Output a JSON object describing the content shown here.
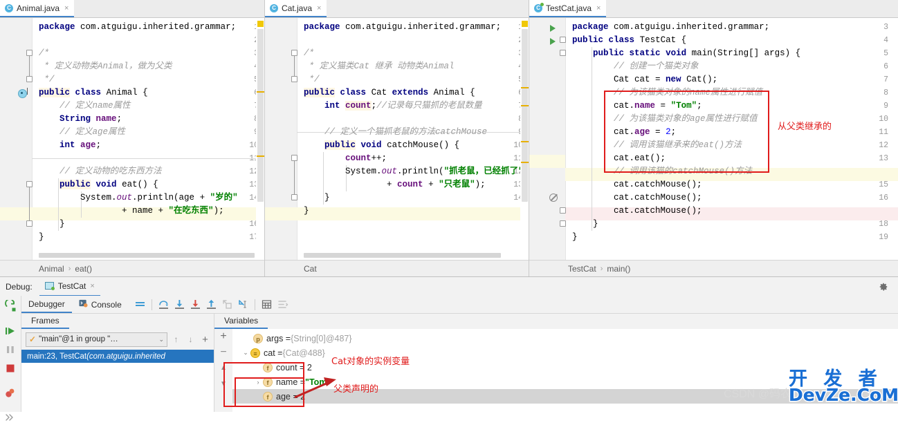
{
  "editors": [
    {
      "tab": {
        "label": "Animal.java",
        "icon": "java-class-icon",
        "modified": false,
        "close": "×"
      },
      "breadcrumb": [
        "Animal",
        "eat()"
      ],
      "first_line": 1,
      "lines": [
        {
          "n": 1,
          "html": "<span class=\"kw\">package</span> <span class=\"pln\">com.atguigu.inherited.grammar;</span>"
        },
        {
          "n": 2,
          "html": ""
        },
        {
          "n": 3,
          "html": "<span class=\"cmt\">/*</span>"
        },
        {
          "n": 4,
          "html": "<span class=\"cmt\"> * 定义动物类Animal，做为父类</span>"
        },
        {
          "n": 5,
          "html": "<span class=\"cmt\"> */</span>"
        },
        {
          "n": 6,
          "html": "<span class=\"kwhl\">public</span> <span class=\"kw\">class</span> <span class=\"pln\">Animal {</span>"
        },
        {
          "n": 7,
          "html": "    <span class=\"cmt\">// 定义name属性</span>"
        },
        {
          "n": 8,
          "html": "    <span class=\"kw\">String</span> <span class=\"fld\">name</span><span class=\"pln\">;</span>"
        },
        {
          "n": 9,
          "html": "    <span class=\"cmt\">// 定义age属性</span>"
        },
        {
          "n": 10,
          "html": "    <span class=\"kw\">int</span> <span class=\"fld\">age</span><span class=\"pln\">;</span>"
        },
        {
          "n": 11,
          "html": ""
        },
        {
          "n": 12,
          "html": "    <span class=\"cmt\">// 定义动物的吃东西方法</span>"
        },
        {
          "n": 13,
          "html": "    <span class=\"kwhl\">public</span> <span class=\"kw\">void</span> <span class=\"pln\">eat() {</span>"
        },
        {
          "n": 14,
          "html": "        <span class=\"pln\">System.</span><span class=\"stat\">out</span><span class=\"pln\">.println(age + </span><span class=\"str\">\"岁的\"</span>"
        },
        {
          "n": 15,
          "html": "                <span class=\"pln\">+ name + </span><span class=\"str\">\"在吃东西\"</span><span class=\"pln\">);</span>",
          "highlight": "yellow"
        },
        {
          "n": 16,
          "html": "    <span class=\"pln\">}</span>"
        },
        {
          "n": 17,
          "html": "<span class=\"pln\">}</span>"
        }
      ]
    },
    {
      "tab": {
        "label": "Cat.java",
        "icon": "java-class-icon",
        "modified": false,
        "close": "×"
      },
      "breadcrumb": [
        "Cat"
      ],
      "first_line": 1,
      "lines": [
        {
          "n": 1,
          "html": "<span class=\"kw\">package</span> <span class=\"pln\">com.atguigu.inherited.grammar;</span>"
        },
        {
          "n": 2,
          "html": ""
        },
        {
          "n": 3,
          "html": "<span class=\"cmt\">/*</span>"
        },
        {
          "n": 4,
          "html": "<span class=\"cmt\"> * 定义猫类Cat 继承 动物类Animal</span>"
        },
        {
          "n": 5,
          "html": "<span class=\"cmt\"> */</span>"
        },
        {
          "n": 6,
          "html": "<span class=\"kwhl\">public</span> <span class=\"kw\">class</span> <span class=\"pln\">Cat </span><span class=\"kw\">extends</span> <span class=\"pln\">Animal {</span>"
        },
        {
          "n": 7,
          "html": "    <span class=\"kw\">int</span> <span class=\"fldhl\">count</span><span class=\"pln\">;</span><span class=\"cmt\">//记录每只猫抓的老鼠数量</span>"
        },
        {
          "n": 8,
          "html": ""
        },
        {
          "n": 9,
          "html": "    <span class=\"cmt\">// 定义一个猫抓老鼠的方法catchMouse</span>"
        },
        {
          "n": 10,
          "html": "    <span class=\"kwhl\">public</span> <span class=\"kw\">void</span> <span class=\"pln\">catchMouse() {</span>"
        },
        {
          "n": 11,
          "html": "        <span class=\"fld\">count</span><span class=\"pln\">++;</span>"
        },
        {
          "n": 12,
          "html": "        <span class=\"pln\">System.</span><span class=\"stat\">out</span><span class=\"pln\">.println(</span><span class=\"str\">\"抓老鼠，已经抓了\"</span>"
        },
        {
          "n": 13,
          "html": "                <span class=\"pln\">+ </span><span class=\"fld\">count</span><span class=\"pln\"> + </span><span class=\"str\">\"只老鼠\"</span><span class=\"pln\">);</span>"
        },
        {
          "n": 14,
          "html": "    <span class=\"pln\">}</span>"
        },
        {
          "n": 15,
          "html": "<span class=\"pln\">}</span>",
          "highlight": "yellow"
        }
      ]
    },
    {
      "tab": {
        "label": "TestCat.java",
        "icon": "java-class-icon",
        "modified": true,
        "close": "×"
      },
      "breadcrumb": [
        "TestCat",
        "main()"
      ],
      "first_line": 3,
      "lines": [
        {
          "n": 3,
          "html": "<span class=\"kw\">package</span> <span class=\"pln\">com.atguigu.inherited.grammar;</span>",
          "gutter": "run"
        },
        {
          "n": 4,
          "html": "<span class=\"kw\">public</span> <span class=\"kw\">class</span> <span class=\"pln\">TestCat {</span>",
          "gutter": "run"
        },
        {
          "n": 5,
          "html": "    <span class=\"kw\">public</span> <span class=\"kw\">static</span> <span class=\"kw\">void</span> <span class=\"pln\">main(String[] args) {</span>"
        },
        {
          "n": 6,
          "html": "        <span class=\"cmt\">// 创建一个猫类对象</span>"
        },
        {
          "n": 7,
          "html": "        <span class=\"pln\">Cat cat = </span><span class=\"kw\">new</span> <span class=\"pln\">Cat();</span>"
        },
        {
          "n": 8,
          "html": "        <span class=\"cmt\">// 为该猫类对象的name属性进行赋值</span>"
        },
        {
          "n": 9,
          "html": "        <span class=\"pln\">cat.</span><span class=\"fld\">name</span><span class=\"pln\"> = </span><span class=\"str\">\"Tom\"</span><span class=\"pln\">;</span>"
        },
        {
          "n": 10,
          "html": "        <span class=\"cmt\">// 为该猫类对象的age属性进行赋值</span>"
        },
        {
          "n": 11,
          "html": "        <span class=\"pln\">cat.</span><span class=\"fld\">age</span><span class=\"pln\"> = </span><span class=\"num\">2</span><span class=\"pln\">;</span>"
        },
        {
          "n": 12,
          "html": "        <span class=\"cmt\">// 调用该猫继承来的eat()方法</span>"
        },
        {
          "n": 13,
          "html": "        <span class=\"pln\">cat.eat();</span>",
          "highlight": "yellow-num"
        },
        {
          "n": 14,
          "html": "        <span class=\"cmt\">// 调用该猫的catchMouse()方法</span>",
          "highlight": "yellow"
        },
        {
          "n": 15,
          "html": "        <span class=\"pln\">cat.catchMouse();</span>"
        },
        {
          "n": 16,
          "html": "        <span class=\"pln\">cat.catchMouse();</span>",
          "gutter": "noentry"
        },
        {
          "n": 17,
          "html": "        <span class=\"pln\">cat.catchMouse();</span>",
          "highlight": "pink"
        },
        {
          "n": 18,
          "html": "    <span class=\"pln\">}</span>"
        },
        {
          "n": 19,
          "html": "<span class=\"pln\">}</span>"
        }
      ]
    }
  ],
  "annotations": {
    "inherited_from_parent": "从父类继承的",
    "cat_instance_vars": "Cat对象的实例变量",
    "declared_by_parent": "父类声明的",
    "box_color": "#e01b1b"
  },
  "debug": {
    "label": "Debug:",
    "session_tab": "TestCat",
    "session_close": "×",
    "gear": "settings-gear",
    "tabs": [
      {
        "label": "Debugger",
        "selected": true
      },
      {
        "label": "Console",
        "selected": false
      }
    ],
    "toolbar_icons": [
      "mute-breakpoints-icon",
      "step-over-icon",
      "step-into-icon",
      "force-step-into-icon",
      "step-out-icon",
      "drop-frame-icon",
      "run-to-cursor-icon",
      "evaluate-expression-icon",
      "show-execution-point-icon"
    ],
    "rail_icons": [
      "rerun-icon",
      "resume-icon",
      "pause-icon",
      "stop-icon",
      "view-breakpoints-icon",
      "mute-icon"
    ],
    "frames": {
      "header": "Frames",
      "thread": "\"main\"@1 in group \"…",
      "thread_caret": "⌄",
      "up_btn": "↑",
      "down_btn": "↓",
      "add_btn": "+",
      "items": [
        {
          "main": "main:23, TestCat ",
          "italic": "(com.atguigu.inherited"
        }
      ]
    },
    "variables": {
      "header": "Variables",
      "buttons": [
        "+",
        "−",
        "▲",
        "▼"
      ],
      "rows": [
        {
          "indent": 1,
          "twisty": "",
          "badge": "p",
          "name": "args = ",
          "value": "{String[0]@487}",
          "value_class": "vgrey"
        },
        {
          "indent": 0,
          "twisty": "⌄",
          "badge": "≡",
          "name": "cat = ",
          "value": "{Cat@488}",
          "value_class": "vgrey"
        },
        {
          "indent": 2,
          "twisty": "",
          "badge": "f",
          "name": "count = 2",
          "value": "",
          "value_class": ""
        },
        {
          "indent": 2,
          "twisty": "›",
          "badge": "f",
          "name": "name = ",
          "value": "\"Tom\"",
          "value_class": "vstr"
        },
        {
          "indent": 2,
          "twisty": "",
          "badge": "f",
          "name": "age = 2",
          "value": "",
          "value_class": "",
          "selected": true
        }
      ]
    }
  },
  "watermark": {
    "csdn": "CSDN @码农",
    "cn": "开 发 者",
    "en": "DevZe.CoM"
  }
}
